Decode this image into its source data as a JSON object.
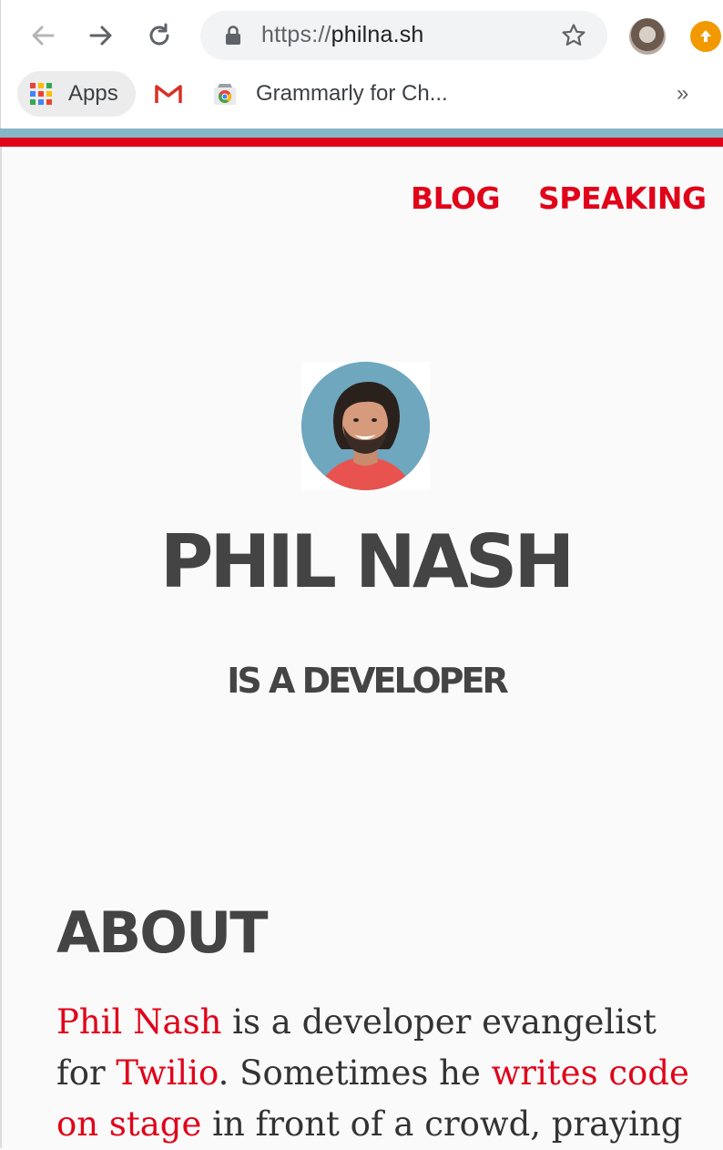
{
  "browser": {
    "url_scheme": "https://",
    "url_host": "philna.sh",
    "bookmarks": {
      "apps_label": "Apps",
      "grammarly_label": "Grammarly for Ch...",
      "overflow_label": "»"
    },
    "icons": [
      "back-icon",
      "forward-icon",
      "reload-icon",
      "lock-icon",
      "bookmark-star-icon",
      "profile-avatar",
      "update-icon",
      "apps-grid-icon",
      "gmail-icon",
      "chrome-web-store-icon"
    ]
  },
  "site": {
    "nav": {
      "blog": "BLOG",
      "speaking": "SPEAKING"
    },
    "hero": {
      "name": "PHIL NASH",
      "tagline": "IS A DEVELOPER"
    },
    "about": {
      "heading": "ABOUT",
      "p_name_link": "Phil Nash",
      "p_text_1": " is a developer evangelist for ",
      "p_twilio_link": "Twilio",
      "p_text_2": ". Sometimes he ",
      "p_code_link": "writes code on stage",
      "p_text_3": " in front of a crowd, praying"
    }
  },
  "colors": {
    "accent_red": "#e0031a",
    "stripe_blue": "#85b5c7",
    "heading_gray": "#444444",
    "page_bg": "#fafafa"
  }
}
